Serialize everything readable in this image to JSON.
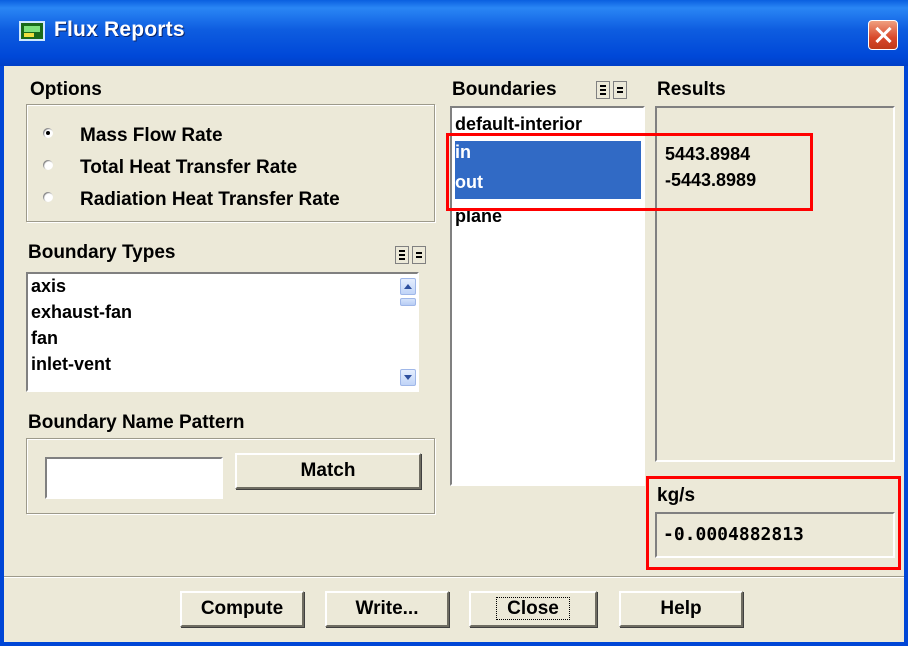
{
  "window": {
    "title": "Flux Reports"
  },
  "options": {
    "label": "Options",
    "radios": [
      {
        "label": "Mass Flow Rate",
        "selected": true
      },
      {
        "label": "Total Heat Transfer Rate",
        "selected": false
      },
      {
        "label": "Radiation Heat Transfer Rate",
        "selected": false
      }
    ]
  },
  "boundary_types": {
    "label": "Boundary Types",
    "items": [
      "axis",
      "exhaust-fan",
      "fan",
      "inlet-vent"
    ]
  },
  "boundary_name_pattern": {
    "label": "Boundary Name Pattern",
    "value": "",
    "match_label": "Match"
  },
  "boundaries": {
    "label": "Boundaries",
    "items": [
      {
        "label": "default-interior",
        "selected": false
      },
      {
        "label": "in",
        "selected": true
      },
      {
        "label": "out",
        "selected": true
      },
      {
        "label": "plane",
        "selected": false
      }
    ]
  },
  "results": {
    "label": "Results",
    "values": [
      "5443.8984",
      "-5443.8989"
    ],
    "unit": "kg/s",
    "net": "-0.0004882813"
  },
  "buttons": {
    "compute": "Compute",
    "write": "Write...",
    "close": "Close",
    "help": "Help"
  },
  "colors": {
    "selection": "#316ac5",
    "annotation": "#ff0000",
    "dialog_bg": "#ece9d8"
  }
}
